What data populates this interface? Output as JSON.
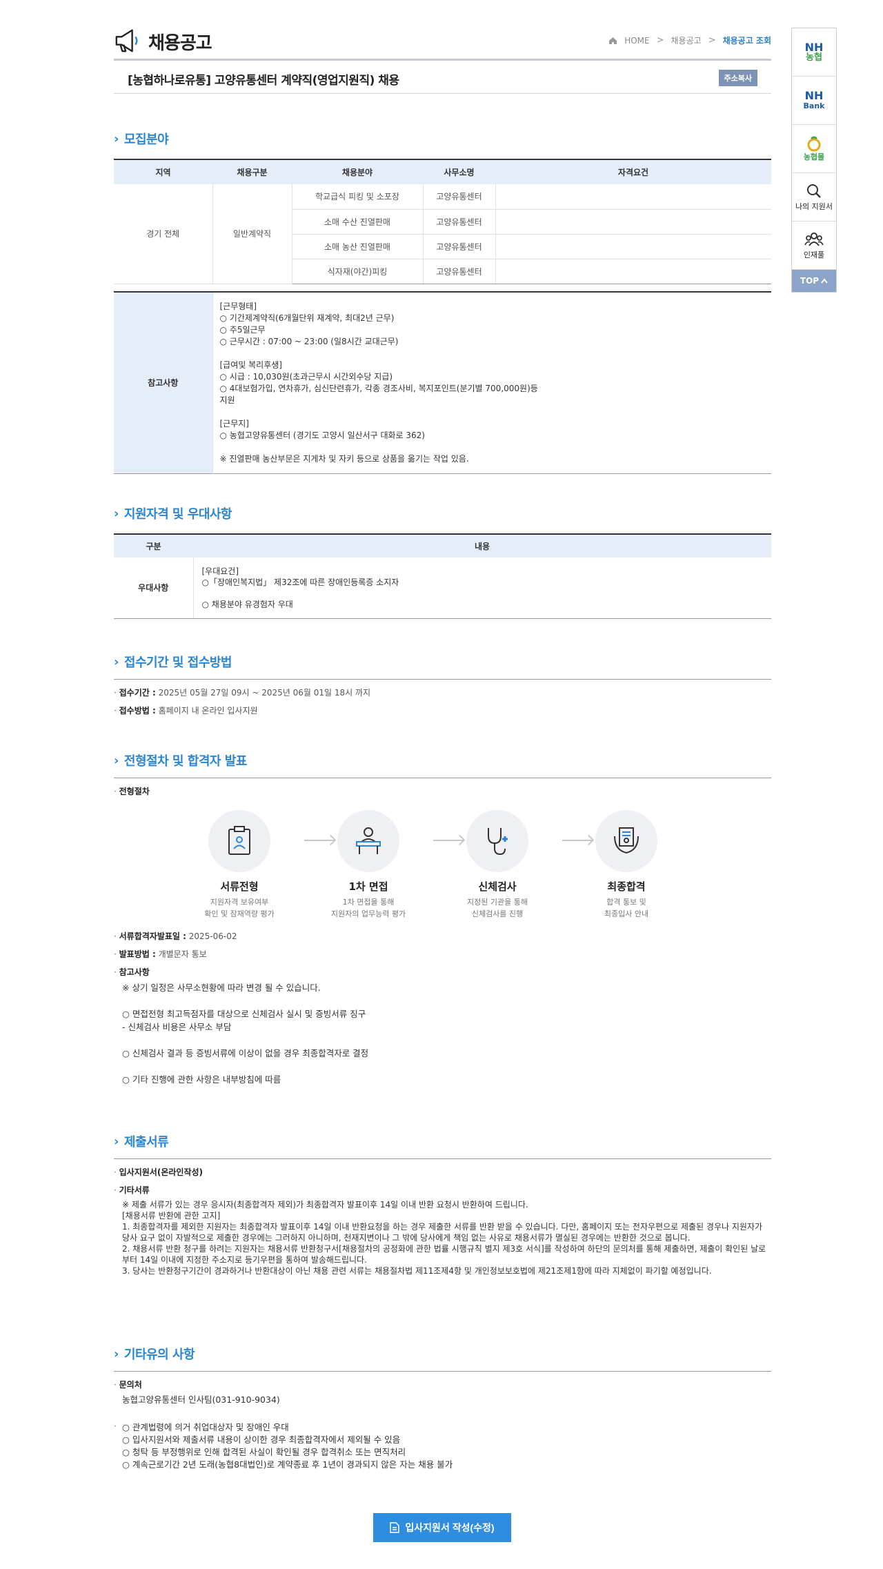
{
  "header": {
    "title": "채용공고",
    "breadcrumb": [
      "HOME",
      "채용공고",
      "채용공고 조회"
    ],
    "job_title": "[농협하나로유통] 고양유통센터 계약직(영업지원직) 채용",
    "copy_button": "주소복사"
  },
  "recruit": {
    "section_title": "모집분야",
    "columns": [
      "지역",
      "채용구분",
      "채용분야",
      "사무소명",
      "자격요건"
    ],
    "region": "경기 전체",
    "type": "일반계약직",
    "rows": [
      {
        "field": "학교급식 피킹 및 소포장",
        "office": "고양유통센터"
      },
      {
        "field": "소매 수산 진열판매",
        "office": "고양유통센터"
      },
      {
        "field": "소매 농산 진열판매",
        "office": "고양유통센터"
      },
      {
        "field": "식자재(야간)피킹",
        "office": "고양유통센터"
      }
    ],
    "note_label": "참고사항",
    "note_text": "[근무형태]\n○ 기간제계약직(6개월단위 재계약, 최대2년 근무)\n○ 주5일근무\n○ 근무시간 : 07:00 ~ 23:00 (일8시간 교대근무)\n\n[급여및 복리후생]\n○ 시급 : 10,030원(초과근무시 시간외수당 지급)\n○ 4대보험가입, 연차휴가, 심신단련휴가, 각종 경조사비, 복지포인트(분기별 700,000원)등\n지원\n\n[근무지]\n○ 농협고양유통센터 (경기도 고양시 일산서구 대화로 362)\n\n ※ 진열판매 농산부문은 지게차 및 자키 등으로 상품을 옮기는 작업 있음."
  },
  "qualify": {
    "section_title": "지원자격 및 우대사항",
    "columns": [
      "구분",
      "내용"
    ],
    "row_label": "우대사항",
    "row_text": "[우대요건]\n○「장애인복지법」 제32조에 따른 장애인등록증 소지자\n\n○ 채용분야 유경험자 우대"
  },
  "receipt": {
    "section_title": "접수기간 및 접수방법",
    "period_label": "접수기간 :",
    "period_value": " 2025년 05월 27일 09시 ~ 2025년 06월 01일 18시 까지",
    "method_label": "접수방법 :",
    "method_value": " 홈페이지 내 온라인 입사지원"
  },
  "process": {
    "section_title": "전형절차 및 합격자 발표",
    "sub_label": "전형절차",
    "steps": [
      {
        "name": "서류전형",
        "desc": "지원자격 보유여부\n확인 및 잠재역량 평가"
      },
      {
        "name": "1차 면접",
        "desc": "1차 면접을 통해\n지원자의 업무능력 평가"
      },
      {
        "name": "신체검사",
        "desc": "지정된 기관을 통해\n신체검사를 진행"
      },
      {
        "name": "최종합격",
        "desc": "합격 통보 및\n최종입사 안내"
      }
    ],
    "announce_label": "서류합격자발표일 :",
    "announce_value": " 2025-06-02",
    "notify_label": "발표방법 :",
    "notify_value": " 개별문자 통보",
    "ref_label": "참고사항",
    "ref_text": "※ 상기 일정은 사무소현황에 따라 변경 될 수 있습니다.\n\n○ 면접전형 최고득점자를 대상으로 신체검사 실시 및 증빙서류 징구\n - 신체검사 비용은 사무소 부담\n\n○ 신체검사 결과 등 증빙서류에 이상이 없을 경우 최종합격자로 결정\n\n○ 기타 진행에 관한 사항은 내부방침에 따름"
  },
  "docs": {
    "section_title": "제출서류",
    "item1": "입사지원서(온라인작성)",
    "item2": "기타서류",
    "text": "※ 제출 서류가 있는 경우 응시자(최종합격자 제외)가 최종합격자 발표이후 14일 이내 반환 요청시 반환하여 드립니다.\n[채용서류 반환에 관한 고지]\n 1. 최종합격자를 제외한 지원자는 최종합격자 발표이후 14일 이내 반환요청을 하는 경우 제출한 서류를 반환 받을 수 있습니다. 다만, 홈페이지 또는 전자우편으로 제출된 경우나 지원자가 당사 요구 없이 자발적으로 제출한 경우에는 그러하지 아니하며, 천재지변이나 그 밖에 당사에게 책임 없는 사유로 채용서류가 멸실된 경우에는 반환한 것으로 봅니다.\n 2. 채용서류 반환 청구를 하려는 지원자는 채용서류 반환청구서[채용절차의 공정화에 관한 법률 시행규칙 별지 제3호 서식]를 작성하여 하단의 문의처를 통해 제출하면, 제출이 확인된 날로부터 14일 이내에 지정한 주소지로 등기우편을 통하여 발송해드립니다.\n 3. 당사는 반환청구기간이 경과하거나 반환대상이 아닌 채용 관련 서류는 채용절차법 제11조제4항 및 개인정보보호법에 제21조제1항에 따라 지체없이 파기할 예정입니다."
  },
  "etc": {
    "section_title": "기타유의 사항",
    "contact_label": "문의처",
    "contact_value": "농협고양유통센터 인사팀(031-910-9034)",
    "notes": "○ 관계법령에 의거 취업대상자 및 장애인 우대\n○ 입사지원서와 제출서류 내용이 상이한 경우 최종합격자에서 제외될 수 있음\n○ 청탁 등 부정행위로 인해 합격된 사실이 확인될 경우 합격취소 또는 면직처리\n○ 계속근로기간 2년 도래(농협8대법인)로 계약종료 후 1년이 경과되지 않은 자는 채용 불가"
  },
  "apply_button": "입사지원서 작성(수정)",
  "quick_menu": {
    "nh_top": "NH",
    "nh_bottom": "농협",
    "bank_top": "NH",
    "bank_bottom": "Bank",
    "mall": "농협몰",
    "my_apply": "나의 지원서",
    "talent": "인재풀",
    "top": "TOP"
  },
  "colors": {
    "accent": "#2a86d2",
    "header_bg": "#e5eef8",
    "button": "#2f8de0",
    "quick_top": "#8ba4c9"
  }
}
